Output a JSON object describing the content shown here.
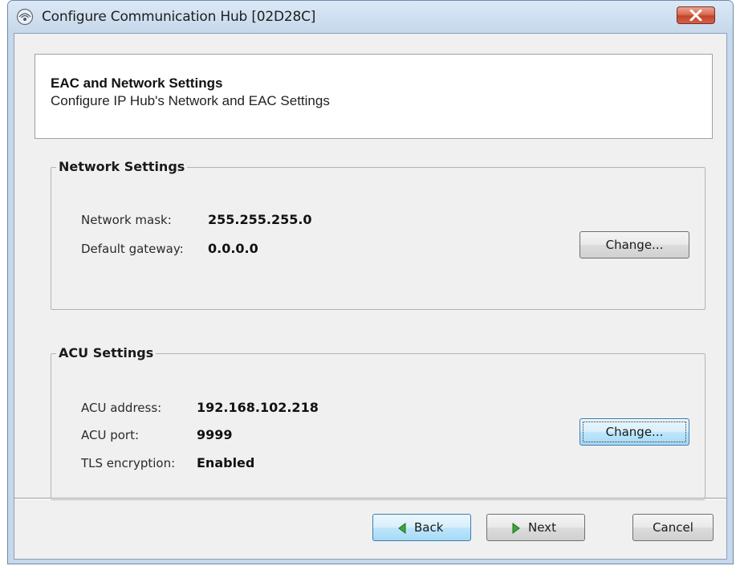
{
  "window": {
    "title": "Configure Communication Hub [02D28C]"
  },
  "header": {
    "title": "EAC and Network Settings",
    "subtitle": "Configure IP Hub's Network and EAC Settings"
  },
  "network_settings": {
    "group_title": "Network Settings",
    "rows": [
      {
        "label": "Network mask:",
        "value": "255.255.255.0"
      },
      {
        "label": "Default gateway:",
        "value": "0.0.0.0"
      }
    ],
    "change_label": "Change..."
  },
  "acu_settings": {
    "group_title": "ACU Settings",
    "rows": [
      {
        "label": "ACU address:",
        "value": "192.168.102.218"
      },
      {
        "label": "ACU port:",
        "value": "9999"
      },
      {
        "label": "TLS encryption:",
        "value": "Enabled"
      }
    ],
    "change_label": "Change..."
  },
  "footer": {
    "back_label": "Back",
    "next_label": "Next",
    "cancel_label": "Cancel"
  },
  "icons": {
    "app": "hub-icon",
    "close": "close-icon",
    "back": "arrow-left-icon",
    "next": "arrow-right-icon"
  },
  "colors": {
    "close_button": "#c4442a",
    "arrow_green": "#3aa83a",
    "focused_button": "#bee6fd"
  }
}
